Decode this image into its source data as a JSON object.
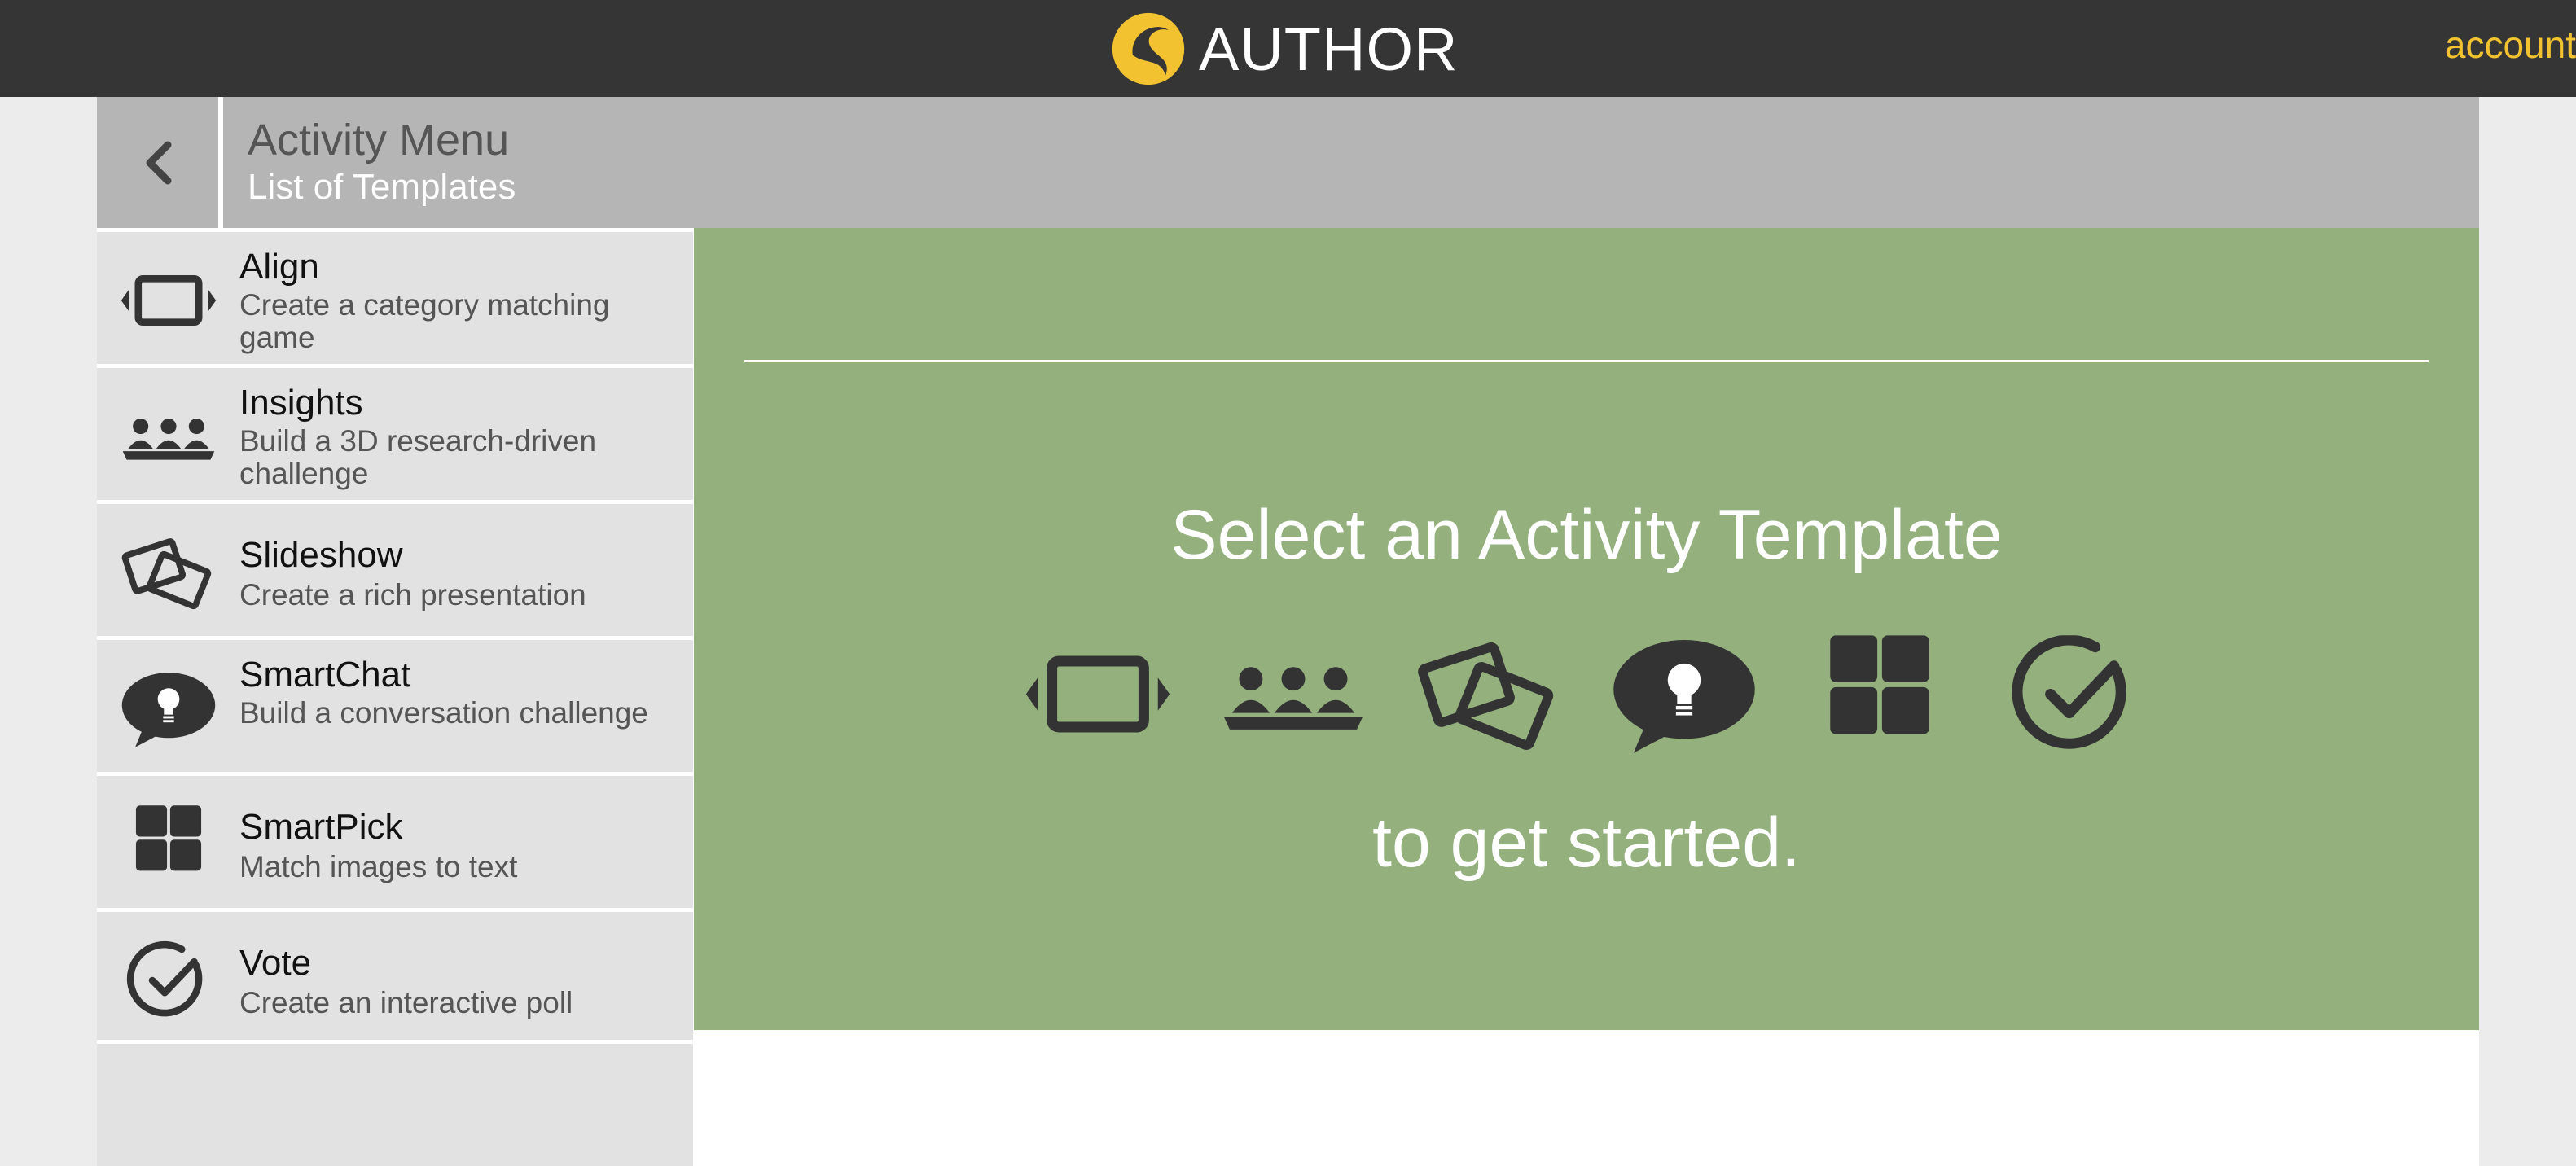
{
  "topbar": {
    "brand_text": "AUTHOR",
    "account_label": "account",
    "logo_icon": "author-logo-icon",
    "logo_color": "#f2c230"
  },
  "header": {
    "back_icon": "chevron-left-icon",
    "title": "Activity Menu",
    "subtitle": "List of Templates"
  },
  "sidebar": {
    "items": [
      {
        "name": "Align",
        "desc": "Create a category matching game",
        "icon": "align-icon"
      },
      {
        "name": "Insights",
        "desc": "Build a 3D research-driven challenge",
        "icon": "insights-icon"
      },
      {
        "name": "Slideshow",
        "desc": "Create a rich presentation",
        "icon": "slideshow-icon"
      },
      {
        "name": "SmartChat",
        "desc": "Build a conversation challenge",
        "icon": "smartchat-icon"
      },
      {
        "name": "SmartPick",
        "desc": "Match images to text",
        "icon": "smartpick-icon"
      },
      {
        "name": "Vote",
        "desc": "Create an interactive poll",
        "icon": "vote-icon"
      }
    ]
  },
  "panel": {
    "heading": "Select an Activity Template",
    "footer": "to get started.",
    "background": "#93b07d"
  },
  "colors": {
    "topbar": "#353535",
    "accent": "#f2c230",
    "header": "#b5b5b5",
    "sidebar": "#e2e2e2",
    "icon": "#333333"
  }
}
